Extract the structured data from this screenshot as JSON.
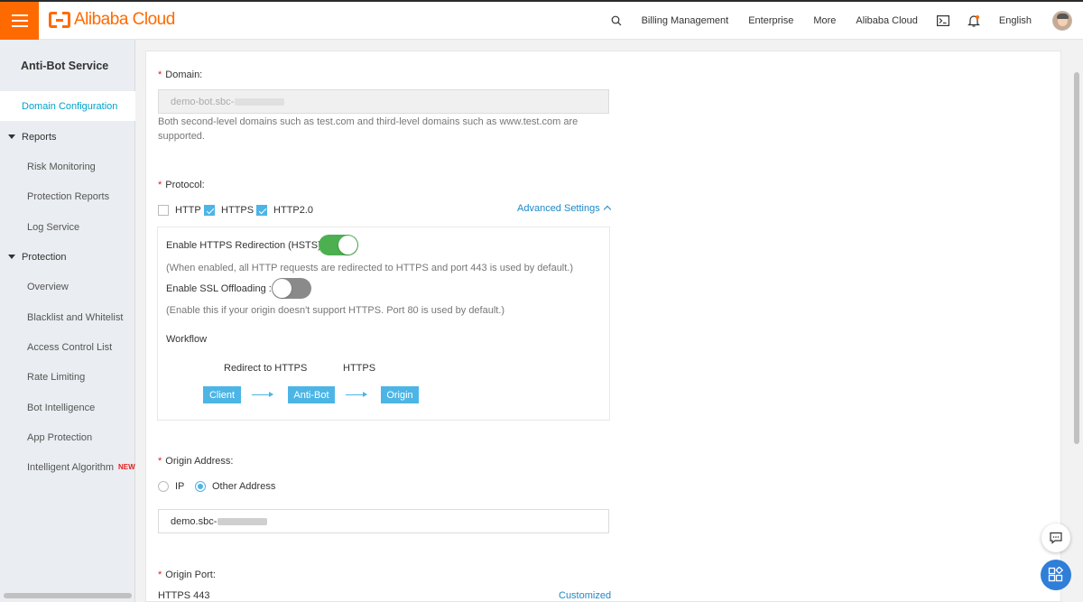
{
  "topbar": {
    "logo_text": "Alibaba Cloud",
    "nav": [
      "Billing Management",
      "Enterprise",
      "More",
      "Alibaba Cloud"
    ],
    "language": "English",
    "icons": [
      "search-icon",
      "terminal-icon",
      "bell-icon",
      "avatar"
    ]
  },
  "sidebar": {
    "title": "Anti-Bot Service",
    "active_item": "Domain Configuration",
    "group_reports": "Reports",
    "reports_items": [
      "Risk Monitoring",
      "Protection Reports",
      "Log Service"
    ],
    "group_protection": "Protection",
    "protection_items": [
      "Overview",
      "Blacklist and Whitelist",
      "Access Control List",
      "Rate Limiting",
      "Bot Intelligence",
      "App Protection",
      "Intelligent Algorithm"
    ],
    "new_badge": "NEW"
  },
  "form": {
    "domain_label": "Domain:",
    "domain_value": "demo-bot.sbc-",
    "domain_hint": "Both second-level domains such as test.com and third-level domains such as www.test.com are supported.",
    "protocol_label": "Protocol:",
    "protocols": [
      {
        "label": "HTTP",
        "checked": false
      },
      {
        "label": "HTTPS",
        "checked": true
      },
      {
        "label": "HTTP2.0",
        "checked": true
      }
    ],
    "advanced_settings": "Advanced Settings",
    "hsts_label": "Enable HTTPS Redirection (HSTS):",
    "hsts_on": true,
    "hsts_hint": "(When enabled, all HTTP requests are redirected to HTTPS and port 443 is used by default.)",
    "ssl_label": "Enable SSL Offloading :",
    "ssl_on": false,
    "ssl_hint": "(Enable this if your origin doesn't support HTTPS. Port 80 is used by default.)",
    "workflow_label": "Workflow",
    "workflow_step1_label": "Redirect to HTTPS",
    "workflow_step2_label": "HTTPS",
    "workflow_nodes": [
      "Client",
      "Anti-Bot",
      "Origin"
    ],
    "origin_address_label": "Origin Address:",
    "origin_options": [
      {
        "label": "IP",
        "selected": false
      },
      {
        "label": "Other Address",
        "selected": true
      }
    ],
    "origin_value": "demo.sbc-",
    "origin_port_label": "Origin Port:",
    "origin_port_value": "HTTPS 443",
    "customized_link": "Customized"
  },
  "colors": {
    "brand": "#ff6a00",
    "accent": "#4cb5e6",
    "active_nav": "#00a2ca",
    "toggle_on": "#4caf50",
    "link": "#1c88c8"
  }
}
